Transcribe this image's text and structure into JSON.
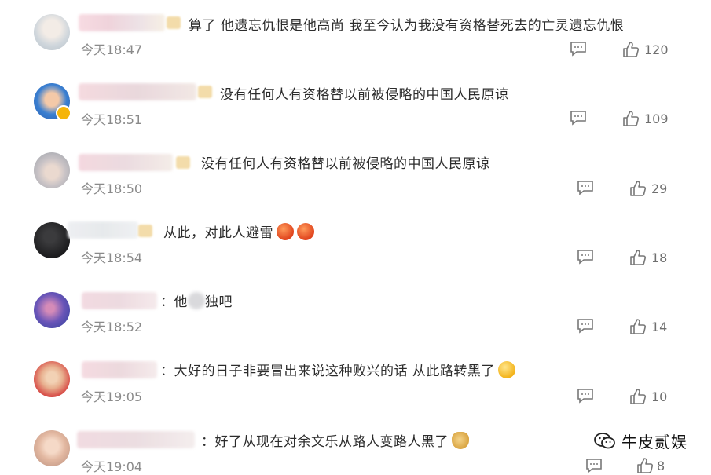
{
  "comments": [
    {
      "text": "算了 他遗忘仇恨是他高尚 我至今认为我没有资格替死去的亡灵遗忘仇恨",
      "time": "今天18:47",
      "likes": "120"
    },
    {
      "text": "没有任何人有资格替以前被侵略的中国人民原谅",
      "time": "今天18:51",
      "likes": "109"
    },
    {
      "text": "没有任何人有资格替以前被侵略的中国人民原谅",
      "time": "今天18:50",
      "likes": "29"
    },
    {
      "text": "从此，对此人避雷",
      "time": "今天18:54",
      "likes": "18",
      "emoji": [
        "angry-face-emoji",
        "angry-face-emoji"
      ]
    },
    {
      "text_prefix": "：他",
      "text_suffix": "独吧",
      "time": "今天18:52",
      "likes": "14"
    },
    {
      "text": "：大好的日子非要冒出来说这种败兴的话 从此路转黑了",
      "time": "今天19:05",
      "likes": "10",
      "emoji": [
        "fearful-face-emoji"
      ]
    },
    {
      "text": "：好了从现在对余文乐从路人变路人黑了",
      "time": "今天19:04",
      "likes": "8",
      "emoji": [
        "folded-hands-emoji"
      ]
    }
  ],
  "watermark": {
    "text": "牛皮贰娱"
  }
}
